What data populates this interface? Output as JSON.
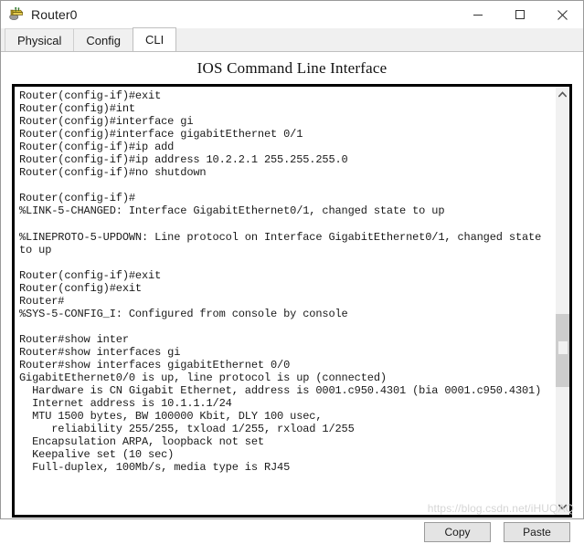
{
  "window": {
    "title": "Router0",
    "icon": "router-icon",
    "controls": {
      "minimize_label": "—",
      "maximize_label": "□",
      "close_label": "✕"
    }
  },
  "tabs": [
    {
      "label": "Physical",
      "active": false
    },
    {
      "label": "Config",
      "active": false
    },
    {
      "label": "CLI",
      "active": true
    }
  ],
  "panel": {
    "heading": "IOS Command Line Interface"
  },
  "terminal": {
    "lines": [
      "Router(config-if)#exit",
      "Router(config)#int",
      "Router(config)#interface gi",
      "Router(config)#interface gigabitEthernet 0/1",
      "Router(config-if)#ip add",
      "Router(config-if)#ip address 10.2.2.1 255.255.255.0",
      "Router(config-if)#no shutdown",
      "",
      "Router(config-if)#",
      "%LINK-5-CHANGED: Interface GigabitEthernet0/1, changed state to up",
      "",
      "%LINEPROTO-5-UPDOWN: Line protocol on Interface GigabitEthernet0/1, changed state",
      "to up",
      "",
      "Router(config-if)#exit",
      "Router(config)#exit",
      "Router#",
      "%SYS-5-CONFIG_I: Configured from console by console",
      "",
      "Router#show inter",
      "Router#show interfaces gi",
      "Router#show interfaces gigabitEthernet 0/0",
      "GigabitEthernet0/0 is up, line protocol is up (connected)",
      "  Hardware is CN Gigabit Ethernet, address is 0001.c950.4301 (bia 0001.c950.4301)",
      "  Internet address is 10.1.1.1/24",
      "  MTU 1500 bytes, BW 100000 Kbit, DLY 100 usec,",
      "     reliability 255/255, txload 1/255, rxload 1/255",
      "  Encapsulation ARPA, loopback not set",
      "  Keepalive set (10 sec)",
      "  Full-duplex, 100Mb/s, media type is RJ45"
    ]
  },
  "scrollbar": {
    "up_arrow": "chevron-up-icon",
    "down_arrow": "chevron-down-icon"
  },
  "actions": {
    "copy_label": "Copy",
    "paste_label": "Paste"
  },
  "watermark": {
    "text": "https://blog.csdn.net/iHUQAQ"
  },
  "colors": {
    "window_bg": "#ffffff",
    "tabstrip_bg": "#f0f0f0",
    "terminal_border": "#000000",
    "terminal_text": "#1a1a1a",
    "button_bg": "#e4e4e4",
    "scroll_thumb": "#cdcdcd",
    "watermark": "#d6d6d6"
  }
}
